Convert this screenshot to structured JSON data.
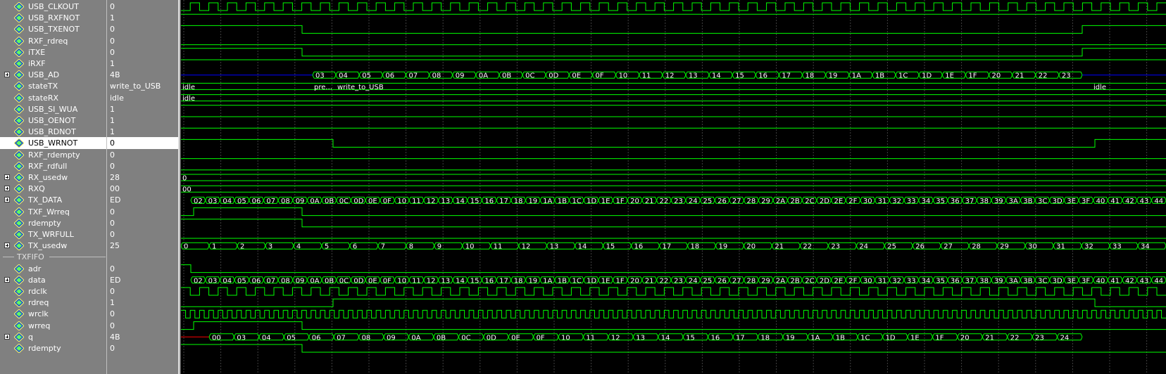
{
  "colors": {
    "wave": "#00ff00",
    "bus": "#00ff00",
    "hiz": "#0000ff",
    "undef": "#ff0000",
    "grid": "#404040",
    "panel": "#808080",
    "text": "#ffffff"
  },
  "signals": [
    {
      "name": "USB_CLKOUT",
      "value": "0",
      "expand": false
    },
    {
      "name": "USB_RXFNOT",
      "value": "1",
      "expand": false
    },
    {
      "name": "USB_TXENOT",
      "value": "0",
      "expand": false
    },
    {
      "name": "RXF_rdreq",
      "value": "0",
      "expand": false
    },
    {
      "name": "iTXE",
      "value": "0",
      "expand": false
    },
    {
      "name": "iRXF",
      "value": "1",
      "expand": false
    },
    {
      "name": "USB_AD",
      "value": "4B",
      "expand": true
    },
    {
      "name": "stateTX",
      "value": "write_to_USB",
      "expand": false
    },
    {
      "name": "stateRX",
      "value": "idle",
      "expand": false
    },
    {
      "name": "USB_SI_WUA",
      "value": "1",
      "expand": false
    },
    {
      "name": "USB_OENOT",
      "value": "1",
      "expand": false
    },
    {
      "name": "USB_RDNOT",
      "value": "1",
      "expand": false
    },
    {
      "name": "USB_WRNOT",
      "value": "0",
      "expand": false,
      "selected": true
    },
    {
      "name": "RXF_rdempty",
      "value": "0",
      "expand": false
    },
    {
      "name": "RXF_rdfull",
      "value": "0",
      "expand": false
    },
    {
      "name": "RX_usedw",
      "value": "28",
      "expand": true
    },
    {
      "name": "RXQ",
      "value": "00",
      "expand": true
    },
    {
      "name": "TX_DATA",
      "value": "ED",
      "expand": true
    },
    {
      "name": "TXF_Wrreq",
      "value": "0",
      "expand": false
    },
    {
      "name": "rdempty",
      "value": "0",
      "expand": false
    },
    {
      "name": "TX_WRFULL",
      "value": "0",
      "expand": false
    },
    {
      "name": "TX_usedw",
      "value": "25",
      "expand": true
    },
    {
      "name": "TXFIFO",
      "group": true
    },
    {
      "name": "adr",
      "value": "0",
      "expand": false
    },
    {
      "name": "data",
      "value": "ED",
      "expand": true
    },
    {
      "name": "rdclk",
      "value": "0",
      "expand": false
    },
    {
      "name": "rdreq",
      "value": "1",
      "expand": false
    },
    {
      "name": "wrclk",
      "value": "0",
      "expand": false
    },
    {
      "name": "wrreq",
      "value": "0",
      "expand": false
    },
    {
      "name": "q",
      "value": "4B",
      "expand": true
    },
    {
      "name": "rdempty",
      "value": "0",
      "expand": false
    }
  ],
  "bus_labels": {
    "USB_AD": [
      "03",
      "04",
      "05",
      "06",
      "07",
      "08",
      "09",
      "0A",
      "0B",
      "0C",
      "0D",
      "0E",
      "0F",
      "10",
      "11",
      "12",
      "13",
      "14",
      "15",
      "16",
      "17",
      "18",
      "19",
      "1A",
      "1B",
      "1C",
      "1D",
      "1E",
      "1F",
      "20",
      "21",
      "22",
      "23"
    ],
    "stateTX": [
      "idle",
      "pre...",
      "write_to_USB",
      "idle"
    ],
    "stateRX": [
      "idle"
    ],
    "RX_usedw": [
      "0"
    ],
    "RXQ": [
      "00"
    ],
    "TX_DATA": [
      "02",
      "03",
      "04",
      "05",
      "06",
      "07",
      "08",
      "09",
      "0A",
      "0B",
      "0C",
      "0D",
      "0E",
      "0F",
      "10",
      "11",
      "12",
      "13",
      "14",
      "15",
      "16",
      "17",
      "18",
      "19",
      "1A",
      "1B",
      "1C",
      "1D",
      "1E",
      "1F",
      "20",
      "21",
      "22",
      "23",
      "24",
      "25",
      "26",
      "27",
      "28",
      "29",
      "2A",
      "2B",
      "2C",
      "2D",
      "2E",
      "2F",
      "30",
      "31",
      "32",
      "33",
      "34",
      "35",
      "36",
      "37",
      "38",
      "39",
      "3A",
      "3B",
      "3C",
      "3D",
      "3E",
      "3F",
      "40",
      "41",
      "42",
      "43",
      "44"
    ],
    "TX_usedw": [
      "0",
      "1",
      "2",
      "3",
      "4",
      "5",
      "6",
      "7",
      "8",
      "9",
      "10",
      "11",
      "12",
      "13",
      "14",
      "15",
      "16",
      "17",
      "18",
      "19",
      "20",
      "21",
      "22",
      "23",
      "24",
      "25",
      "26",
      "27",
      "28",
      "29",
      "30",
      "31",
      "32",
      "33",
      "34"
    ],
    "data": [
      "02",
      "03",
      "04",
      "05",
      "06",
      "07",
      "08",
      "09",
      "0A",
      "0B",
      "0C",
      "0D",
      "0E",
      "0F",
      "10",
      "11",
      "12",
      "13",
      "14",
      "15",
      "16",
      "17",
      "18",
      "19",
      "1A",
      "1B",
      "1C",
      "1D",
      "1E",
      "1F",
      "20",
      "21",
      "22",
      "23",
      "24",
      "25",
      "26",
      "27",
      "28",
      "29",
      "2A",
      "2B",
      "2C",
      "2D",
      "2E",
      "2F",
      "30",
      "31",
      "32",
      "33",
      "34",
      "35",
      "36",
      "37",
      "38",
      "39",
      "3A",
      "3B",
      "3C",
      "3D",
      "3E",
      "3F",
      "40",
      "41",
      "42",
      "43",
      "44"
    ],
    "q": [
      "00",
      "03",
      "04",
      "05",
      "06",
      "07",
      "08",
      "09",
      "0A",
      "0B",
      "0C",
      "0D",
      "0E",
      "0F",
      "10",
      "11",
      "12",
      "13",
      "14",
      "15",
      "16",
      "17",
      "18",
      "19",
      "1A",
      "1B",
      "1C",
      "1D",
      "1E",
      "1F",
      "20",
      "21",
      "22",
      "23",
      "24"
    ]
  }
}
